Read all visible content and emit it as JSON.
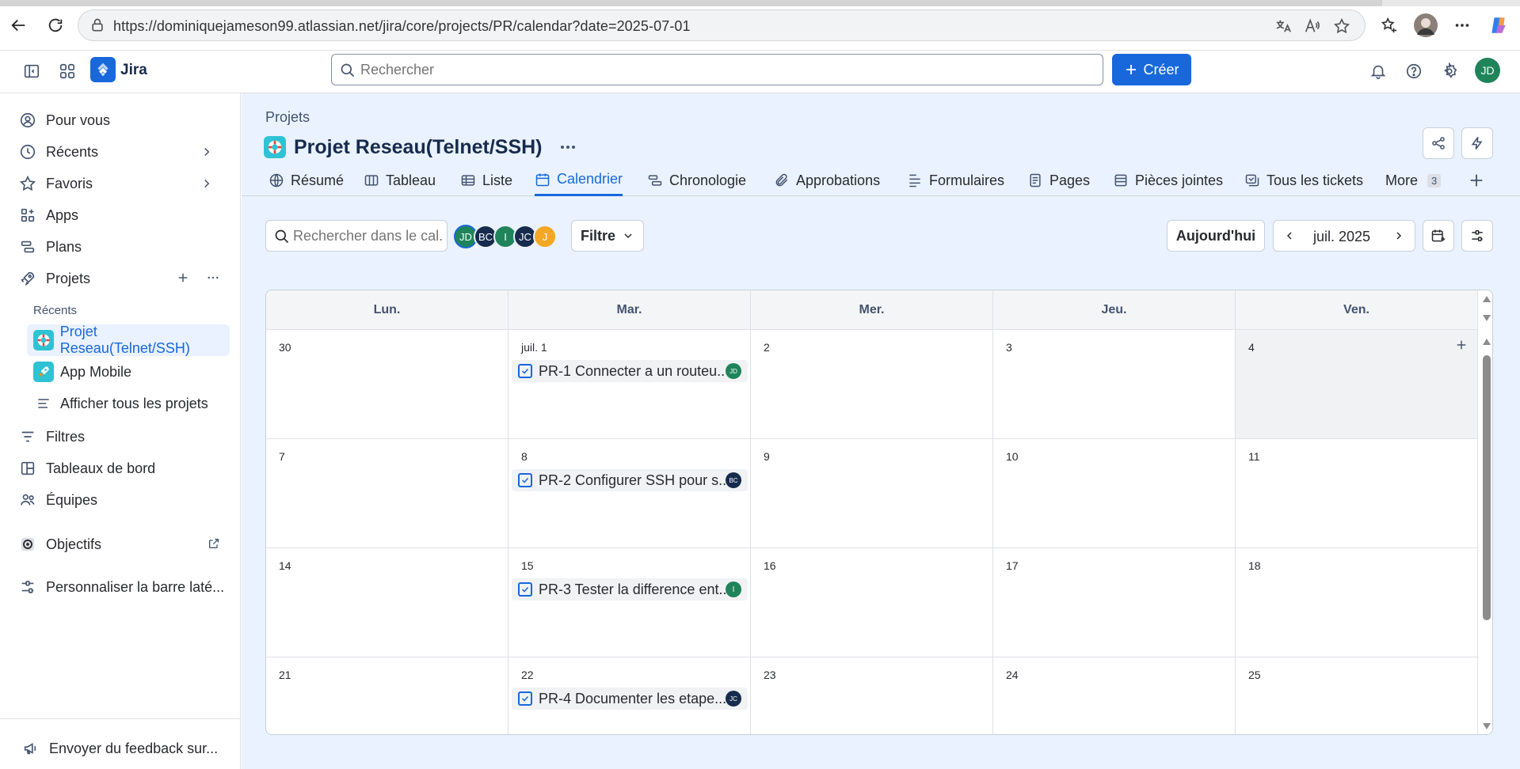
{
  "browser": {
    "url": "https://dominiquejameson99.atlassian.net/jira/core/projects/PR/calendar?date=2025-07-01"
  },
  "header": {
    "app_name": "Jira",
    "search_placeholder": "Rechercher",
    "create_label": "Créer",
    "user_initials": "JD"
  },
  "sidebar": {
    "items": [
      {
        "label": "Pour vous"
      },
      {
        "label": "Récents"
      },
      {
        "label": "Favoris"
      },
      {
        "label": "Apps"
      },
      {
        "label": "Plans"
      },
      {
        "label": "Projets"
      }
    ],
    "recent_section": "Récents",
    "projects": [
      {
        "label": "Projet Reseau(Telnet/SSH)"
      },
      {
        "label": "App Mobile"
      },
      {
        "label": "Afficher tous les projets"
      }
    ],
    "more_items": [
      {
        "label": "Filtres"
      },
      {
        "label": "Tableaux de bord"
      },
      {
        "label": "Équipes"
      }
    ],
    "goals": "Objectifs",
    "customize": "Personnaliser la barre laté...",
    "feedback": "Envoyer du feedback sur..."
  },
  "main": {
    "breadcrumb": "Projets",
    "project_title": "Projet Reseau(Telnet/SSH)",
    "tabs": [
      {
        "label": "Résumé"
      },
      {
        "label": "Tableau"
      },
      {
        "label": "Liste"
      },
      {
        "label": "Calendrier"
      },
      {
        "label": "Chronologie"
      },
      {
        "label": "Approbations"
      },
      {
        "label": "Formulaires"
      },
      {
        "label": "Pages"
      },
      {
        "label": "Pièces jointes"
      },
      {
        "label": "Tous les tickets"
      },
      {
        "label": "More"
      }
    ],
    "more_count": "3"
  },
  "toolbar": {
    "search_placeholder": "Rechercher dans le cal...",
    "avatars": [
      {
        "initials": "JD",
        "color": "#1f845a"
      },
      {
        "initials": "BC",
        "color": "#172b4d"
      },
      {
        "initials": "I",
        "color": "#1f845a"
      },
      {
        "initials": "JC",
        "color": "#172b4d"
      },
      {
        "initials": "J",
        "color": "#f5a623"
      }
    ],
    "avatar_sub": "J",
    "filter_label": "Filtre",
    "today_label": "Aujourd'hui",
    "month_label": "juil. 2025"
  },
  "calendar": {
    "days": [
      "Lun.",
      "Mar.",
      "Mer.",
      "Jeu.",
      "Ven."
    ],
    "weeks": [
      [
        "30",
        "juil. 1",
        "2",
        "3",
        "4"
      ],
      [
        "7",
        "8",
        "9",
        "10",
        "11"
      ],
      [
        "14",
        "15",
        "16",
        "17",
        "18"
      ],
      [
        "21",
        "22",
        "23",
        "24",
        "25"
      ]
    ],
    "events": [
      {
        "text": "PR-1 Connecter a un routeu...",
        "assignee": "JD",
        "color": "#1f845a"
      },
      {
        "text": "PR-2 Configurer SSH pour s...",
        "assignee": "BC",
        "color": "#172b4d"
      },
      {
        "text": "PR-3 Tester la difference ent...",
        "assignee": "I",
        "color": "#1f845a"
      },
      {
        "text": "PR-4 Documenter les etape...",
        "assignee": "JC",
        "color": "#172b4d"
      }
    ]
  },
  "colors": {
    "accent": "#1868db",
    "main_bg": "#e9f2fe"
  }
}
